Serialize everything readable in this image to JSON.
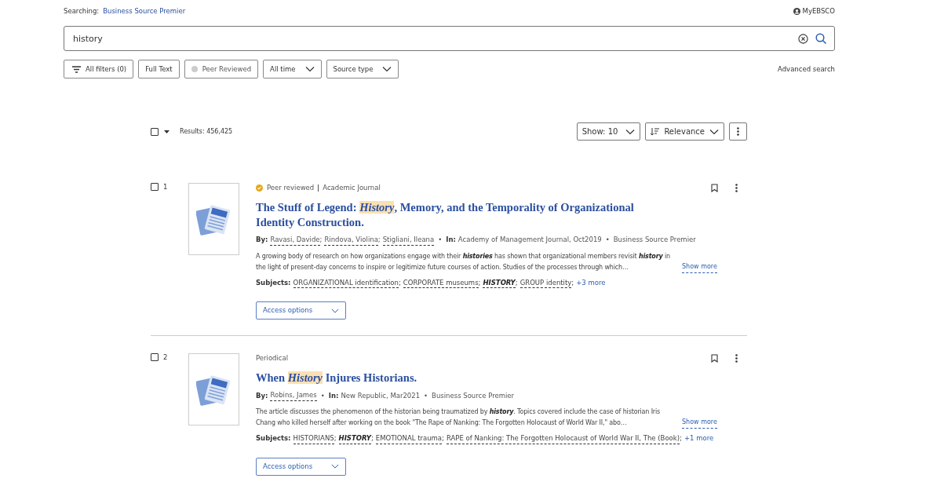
{
  "header": {
    "searching_label": "Searching:",
    "database": "Business Source Premier",
    "account": "MyEBSCO"
  },
  "search": {
    "value": "history"
  },
  "filters": [
    {
      "kind": "filters",
      "label": "All filters (0)"
    },
    {
      "kind": "toggle",
      "label": "Full Text"
    },
    {
      "kind": "check",
      "label": "Peer Reviewed",
      "checked": false
    },
    {
      "kind": "dropdown",
      "label": "All time"
    },
    {
      "kind": "dropdown",
      "label": "Source type"
    }
  ],
  "advanced_search": "Advanced search",
  "results_bar": {
    "select_all_checked": false,
    "count": "Results: 456,425",
    "show": "Show: 10",
    "sort": "Relevance"
  },
  "results": [
    {
      "number": "1",
      "checked": false,
      "peer_reviewed": true,
      "peer_label": "Peer reviewed",
      "type": "Academic Journal",
      "title": [
        {
          "text": "The Stuff of Legend: ",
          "highlight": false
        },
        {
          "text": "History",
          "highlight": true
        },
        {
          "text": ", Memory, and the Temporality of Organizational Identity Construction.",
          "highlight": false
        }
      ],
      "separator": ";",
      "bullet": "•",
      "by_label": "By:",
      "authors": [
        "Ravasi, Davide",
        "Rindova, Violina",
        "Stigliani, Ileana"
      ],
      "in_label": "In:",
      "source": "Academy of Management Journal, Oct2019",
      "database": "Business Source Premier",
      "abstract": "A growing body of research on how organizations engage with their **histories** has shown that organizational members revisit **history** in the light of present-day concerns to inspire or legitimize future courses of action. Studies of the processes through which…",
      "show_more": "Show more",
      "subjects_label": "Subjects:",
      "subjects": [
        {
          "text": "ORGANIZATIONAL identification",
          "matched": false
        },
        {
          "text": "CORPORATE museums",
          "matched": false
        },
        {
          "text": "HISTORY",
          "matched": true
        },
        {
          "text": "GROUP identity",
          "matched": false
        }
      ],
      "more_subjects": "+3 more",
      "access": "Access options"
    },
    {
      "number": "2",
      "checked": false,
      "peer_reviewed": false,
      "type": "Periodical",
      "title": [
        {
          "text": "When ",
          "highlight": false
        },
        {
          "text": "History",
          "highlight": true
        },
        {
          "text": " Injures Historians.",
          "highlight": false
        }
      ],
      "separator": ";",
      "bullet": "•",
      "by_label": "By:",
      "authors": [
        "Robins, James"
      ],
      "in_label": "In:",
      "source": "New Republic, Mar2021",
      "database": "Business Source Premier",
      "abstract": "The article discusses the phenomenon of the historian being traumatized by **history**. Topics covered include the case of historian Iris Chang who killed herself after working on the book \"The Rape of Nanking: The Forgotten Holocaust of World War II,\" abo…",
      "show_more": "Show more",
      "subjects_label": "Subjects:",
      "subjects": [
        {
          "text": "HISTORIANS",
          "matched": false
        },
        {
          "text": "HISTORY",
          "matched": true
        },
        {
          "text": "EMOTIONAL trauma",
          "matched": false
        },
        {
          "text": "RAPE of Nanking: The Forgotten Holocaust of World War II, The (Book)",
          "matched": false
        }
      ],
      "more_subjects": "+1 more",
      "access": "Access options"
    }
  ]
}
